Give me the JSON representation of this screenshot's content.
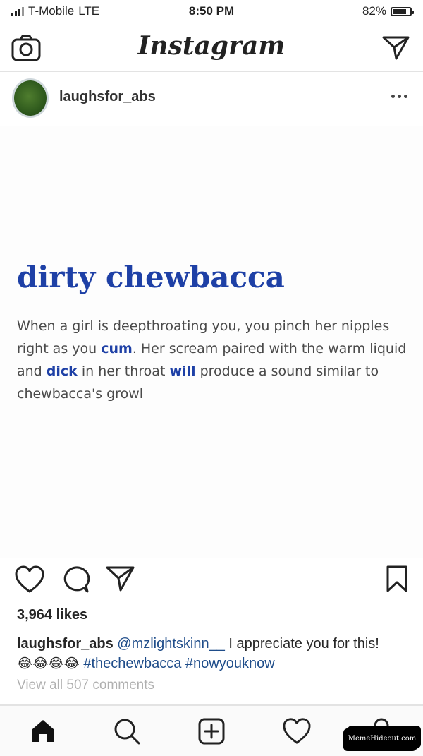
{
  "status_bar": {
    "carrier": "T-Mobile",
    "network": "LTE",
    "time": "8:50 PM",
    "battery_percent": "82%",
    "battery_level": 0.82
  },
  "nav": {
    "logo": "Instagram",
    "icons": {
      "left": "camera-icon",
      "right": "direct-message-icon"
    }
  },
  "post": {
    "username": "laughsfor_abs",
    "more_icon": "more-options-icon",
    "image": {
      "title": "dirty chewbacca",
      "body": [
        {
          "text": "When a girl is deepthroating you, you pinch her nipples right as you ",
          "link": false
        },
        {
          "text": "cum",
          "link": true
        },
        {
          "text": ". Her scream paired with the warm liquid and ",
          "link": false
        },
        {
          "text": "dick",
          "link": true
        },
        {
          "text": " in her throat ",
          "link": false
        },
        {
          "text": "will",
          "link": true
        },
        {
          "text": " produce a sound similar to chewbacca's growl",
          "link": false
        }
      ],
      "link_color": "#1e40a6"
    },
    "actions": {
      "like_icon": "heart-icon",
      "comment_icon": "comment-icon",
      "share_icon": "share-icon",
      "save_icon": "bookmark-icon"
    },
    "likes": "3,964 likes",
    "caption": {
      "username": "laughsfor_abs",
      "mention": "@mzlightskinn__",
      "text": " I appreciate you for this!",
      "emojis": "😂😂😂😂",
      "hashtag_1": "#thechewbacca",
      "hashtag_2": "#nowyouknow"
    },
    "view_comments": "View all 507 comments"
  },
  "tab_bar": {
    "items": [
      "home-icon",
      "search-icon",
      "add-post-icon",
      "activity-heart-icon",
      "profile-icon"
    ]
  },
  "watermark": "MemeHideout.com"
}
